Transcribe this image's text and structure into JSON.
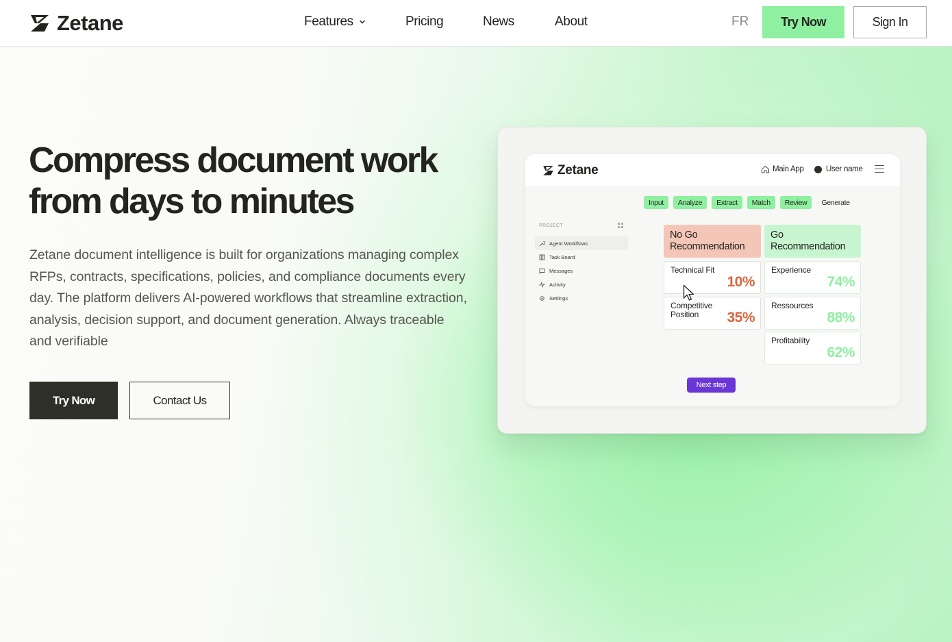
{
  "brand": {
    "name": "Zetane"
  },
  "nav": {
    "links": [
      {
        "label": "Features"
      },
      {
        "label": "Pricing"
      },
      {
        "label": "News"
      },
      {
        "label": "About"
      }
    ],
    "lang": "FR",
    "try_label": "Try Now",
    "signin_label": "Sign In"
  },
  "hero": {
    "title_line1": "Compress document work",
    "title_line2": "from days to minutes",
    "description": "Zetane document intelligence is built for organizations managing complex RFPs, contracts, specifications, policies, and compliance documents every day. The platform delivers AI-powered workflows that streamline extraction, analysis, decision support, and document generation. Always traceable and verifiable",
    "try_label": "Try Now",
    "contact_label": "Contact Us"
  },
  "mockup": {
    "brand": "Zetane",
    "main_app": "Main App",
    "username": "User name",
    "steps": [
      "Input",
      "Analyze",
      "Extract",
      "Match",
      "Review",
      "Generate"
    ],
    "sidebar": {
      "heading": "PROJECT",
      "items": [
        "Agent Workflows",
        "Task Board",
        "Messages",
        "Activity",
        "Settings"
      ]
    },
    "no_go": {
      "title": "No Go Recommendation",
      "metrics": [
        {
          "label": "Technical Fit",
          "value": "10%"
        },
        {
          "label": "Competitive Position",
          "value": "35%"
        }
      ]
    },
    "go": {
      "title": "Go Recommendation",
      "metrics": [
        {
          "label": "Experience",
          "value": "74%"
        },
        {
          "label": "Ressources",
          "value": "88%"
        },
        {
          "label": "Profitability",
          "value": "62%"
        }
      ]
    },
    "next_label": "Next step"
  },
  "colors": {
    "accent_green": "#8ef0a0",
    "dark": "#2e2f28",
    "metric_red": "#d9663e",
    "purple": "#6a37d6"
  }
}
